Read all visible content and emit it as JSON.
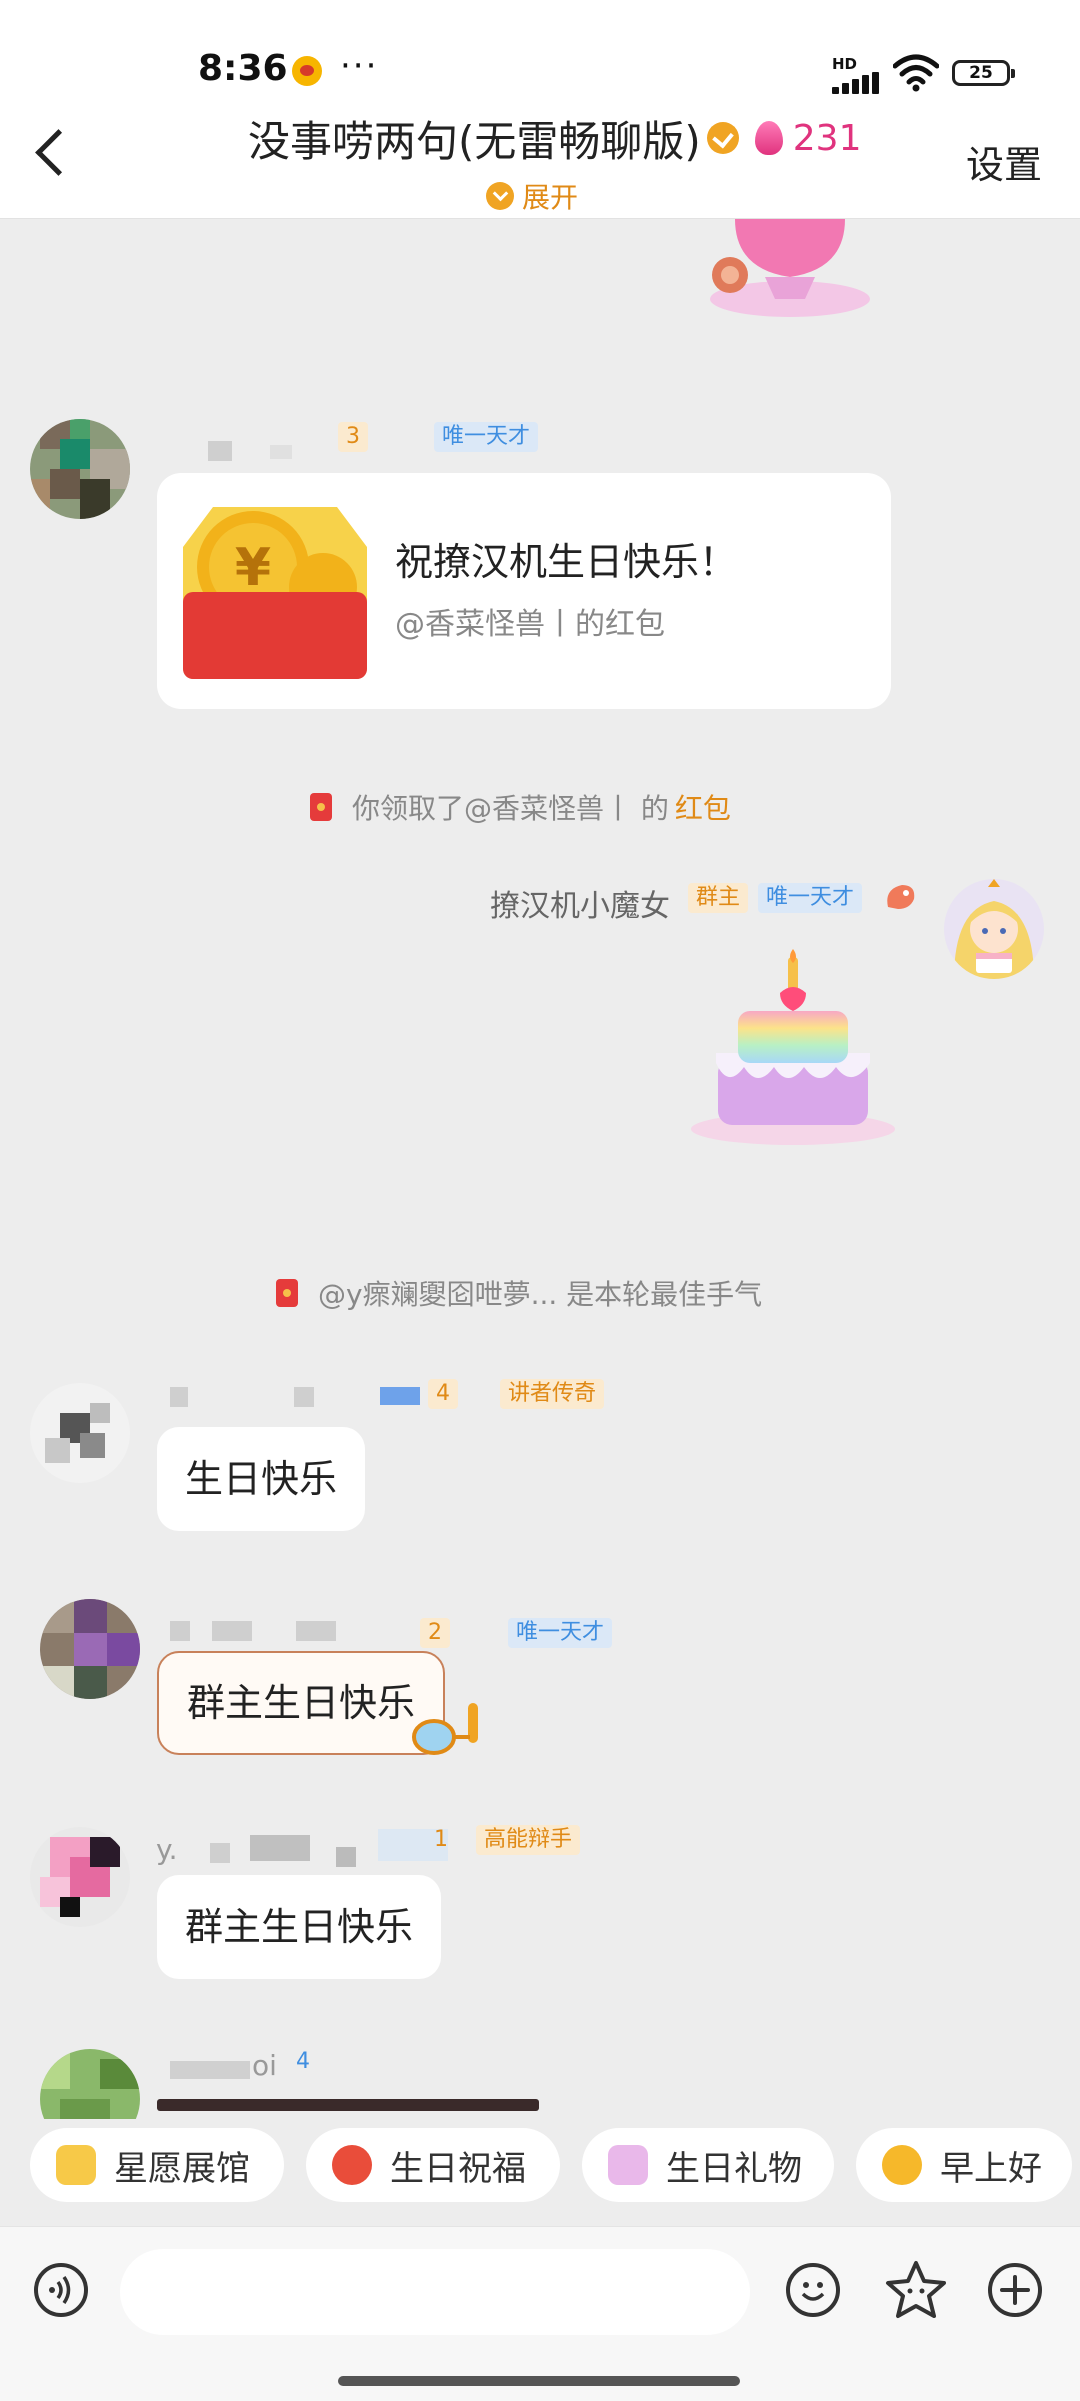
{
  "status_bar": {
    "time": "8:36",
    "more": "···",
    "network": "HD",
    "battery": "25"
  },
  "header": {
    "title": "没事唠两句(无雷畅聊版)",
    "member_count": "231",
    "settings_label": "设置",
    "expand_label": "展开"
  },
  "messages": {
    "m1": {
      "level": "3",
      "tag": "唯一天才",
      "redpacket_title": "祝撩汉机生日快乐！",
      "redpacket_sub": "@香菜怪兽丨的红包"
    },
    "sys1": {
      "prefix": "你领取了@香菜怪兽丨 的",
      "link": "红包"
    },
    "m2": {
      "name": "撩汉机小魔女",
      "role_tag": "群主",
      "tag": "唯一天才"
    },
    "sys2": {
      "text": "@y瘝斓夓囵呭夢... 是本轮最佳手气"
    },
    "m3": {
      "level": "4",
      "tag": "讲者传奇",
      "text": "生日快乐"
    },
    "m4": {
      "level": "2",
      "tag": "唯一天才",
      "text": "群主生日快乐"
    },
    "m5": {
      "name_prefix": "y.",
      "level": "1",
      "tag": "高能辩手",
      "text": "群主生日快乐"
    },
    "m6": {
      "name_suffix": "oi",
      "level": "4"
    }
  },
  "quick_replies": [
    {
      "label": "星愿展馆",
      "icon": "star-wish-icon"
    },
    {
      "label": "生日祝福",
      "icon": "cake-icon"
    },
    {
      "label": "生日礼物",
      "icon": "gift-cake-icon"
    },
    {
      "label": "早上好",
      "icon": "sunflower-icon"
    }
  ],
  "input": {
    "placeholder": ""
  },
  "colors": {
    "accent": "#f0a423",
    "pink": "#e0337e",
    "tag_blue": "#3f8ee0",
    "red_packet": "#e53b3b"
  }
}
